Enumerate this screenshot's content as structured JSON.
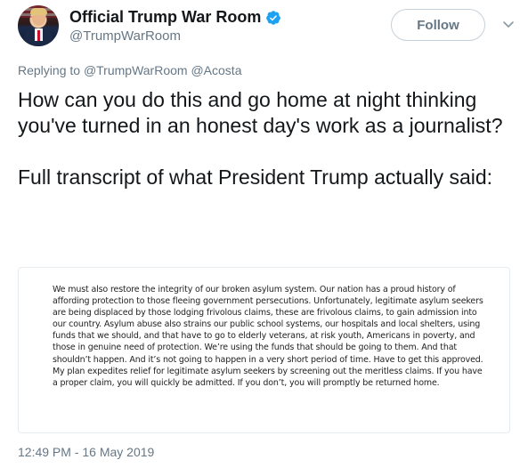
{
  "header": {
    "display_name": "Official Trump War Room",
    "handle": "@TrumpWarRoom",
    "follow_label": "Follow"
  },
  "reply": {
    "prefix": "Replying to",
    "mention_1": "@TrumpWarRoom",
    "mention_2": "@Acosta"
  },
  "tweet": {
    "paragraph_1": "How can you do this and go home at night thinking you've turned in an honest day's work as a journalist?",
    "paragraph_2": "Full transcript of what President Trump actually said:"
  },
  "media": {
    "transcript": "We must also restore the integrity of our broken asylum system. Our nation has a proud history of affording protection to those fleeing government persecutions. Unfortunately, legitimate asylum seekers are being displaced by those lodging frivolous claims, these are frivolous claims, to gain admission into our country. Asylum abuse also strains our public school systems, our hospitals and local shelters, using funds that we should, and that have to go to elderly veterans, at risk youth, Americans in poverty, and those in genuine need of protection. We’re using the funds that should be going to them. And that shouldn’t happen. And it’s not going to happen in a very short period of time. Have to get this approved. My plan expedites relief for legitimate asylum seekers by screening out the meritless claims. If you have a proper claim, you will quickly be admitted. If you don’t, you will promptly be returned home."
  },
  "timestamp": "12:49 PM - 16 May 2019",
  "icons": {
    "verified": "verified-badge-icon",
    "more": "chevron-down-icon"
  },
  "colors": {
    "verified": "#1da1f2",
    "secondary_text": "#657786",
    "primary_text": "#14171a"
  }
}
